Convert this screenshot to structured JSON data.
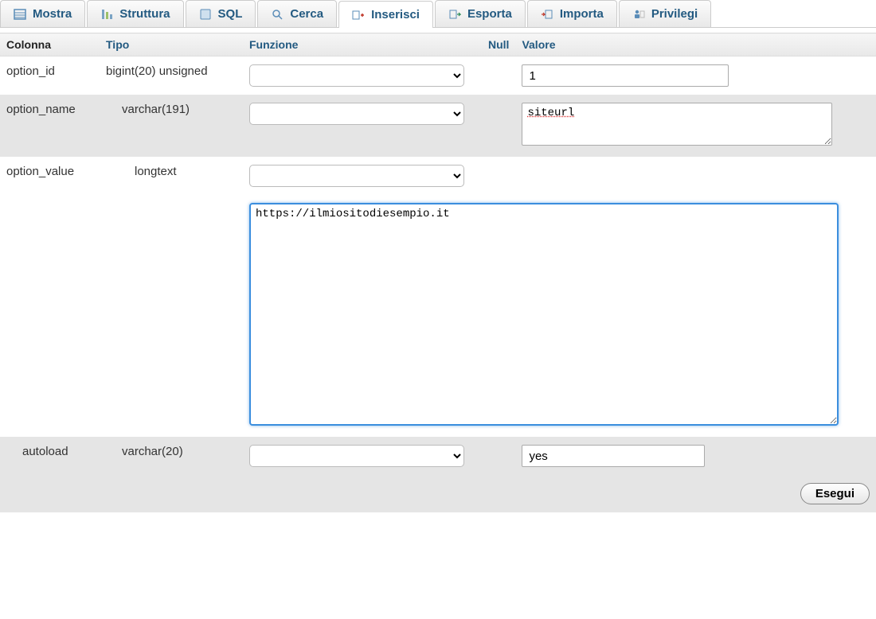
{
  "tabs": [
    {
      "label": "Mostra",
      "icon": "browse-icon"
    },
    {
      "label": "Struttura",
      "icon": "structure-icon"
    },
    {
      "label": "SQL",
      "icon": "sql-icon"
    },
    {
      "label": "Cerca",
      "icon": "search-icon"
    },
    {
      "label": "Inserisci",
      "icon": "insert-icon",
      "active": true
    },
    {
      "label": "Esporta",
      "icon": "export-icon"
    },
    {
      "label": "Importa",
      "icon": "import-icon"
    },
    {
      "label": "Privilegi",
      "icon": "privileges-icon"
    }
  ],
  "headers": {
    "column": "Colonna",
    "type": "Tipo",
    "function": "Funzione",
    "null": "Null",
    "value": "Valore"
  },
  "rows": [
    {
      "column": "option_id",
      "type": "bigint(20) unsigned",
      "value": "1"
    },
    {
      "column": "option_name",
      "type": "varchar(191)",
      "value": "siteurl"
    },
    {
      "column": "option_value",
      "type": "longtext",
      "value": "https://ilmiositodiesempio.it"
    },
    {
      "column": "autoload",
      "type": "varchar(20)",
      "value": "yes"
    }
  ],
  "actions": {
    "execute": "Esegui"
  }
}
